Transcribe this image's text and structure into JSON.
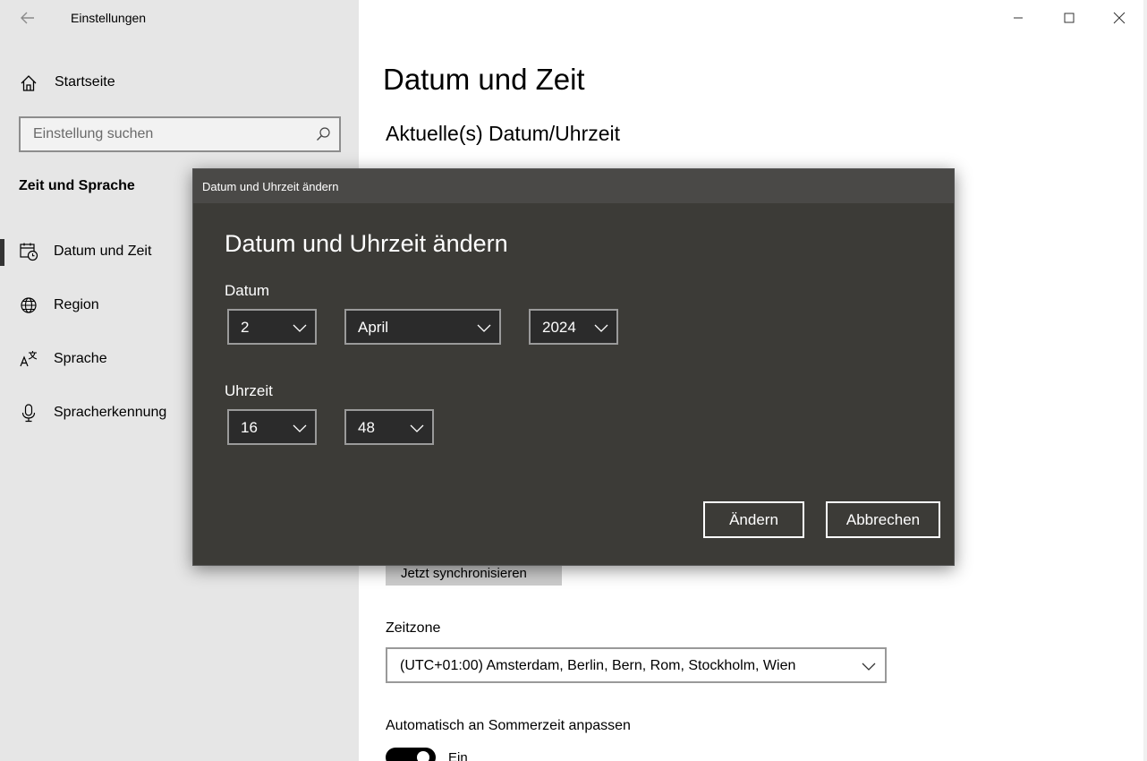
{
  "app": {
    "title": "Einstellungen"
  },
  "sidebar": {
    "home_label": "Startseite",
    "search_placeholder": "Einstellung suchen",
    "section_title": "Zeit und Sprache",
    "items": [
      {
        "label": "Datum und Zeit",
        "icon": "calendar-clock-icon",
        "active": true
      },
      {
        "label": "Region",
        "icon": "globe-icon",
        "active": false
      },
      {
        "label": "Sprache",
        "icon": "language-icon",
        "active": false
      },
      {
        "label": "Spracherkennung",
        "icon": "microphone-icon",
        "active": false
      }
    ]
  },
  "main": {
    "title": "Datum und Zeit",
    "subtitle": "Aktuelle(s) Datum/Uhrzeit",
    "sync_button": "Jetzt synchronisieren",
    "timezone_label": "Zeitzone",
    "timezone_value": "(UTC+01:00) Amsterdam, Berlin, Bern, Rom, Stockholm, Wien",
    "dst_label": "Automatisch an Sommerzeit anpassen",
    "dst_toggle_label": "Ein"
  },
  "dialog": {
    "titlebar": "Datum und Uhrzeit ändern",
    "heading": "Datum und Uhrzeit ändern",
    "date_label": "Datum",
    "day": "2",
    "month": "April",
    "year": "2024",
    "time_label": "Uhrzeit",
    "hour": "16",
    "minute": "48",
    "change_button": "Ändern",
    "cancel_button": "Abbrechen"
  },
  "colors": {
    "sidebar_bg": "#e6e6e6",
    "dialog_bg": "#3c3b37",
    "dialog_titlebar_bg": "#4a4947",
    "dropdown_bg": "#2b2b2b"
  }
}
